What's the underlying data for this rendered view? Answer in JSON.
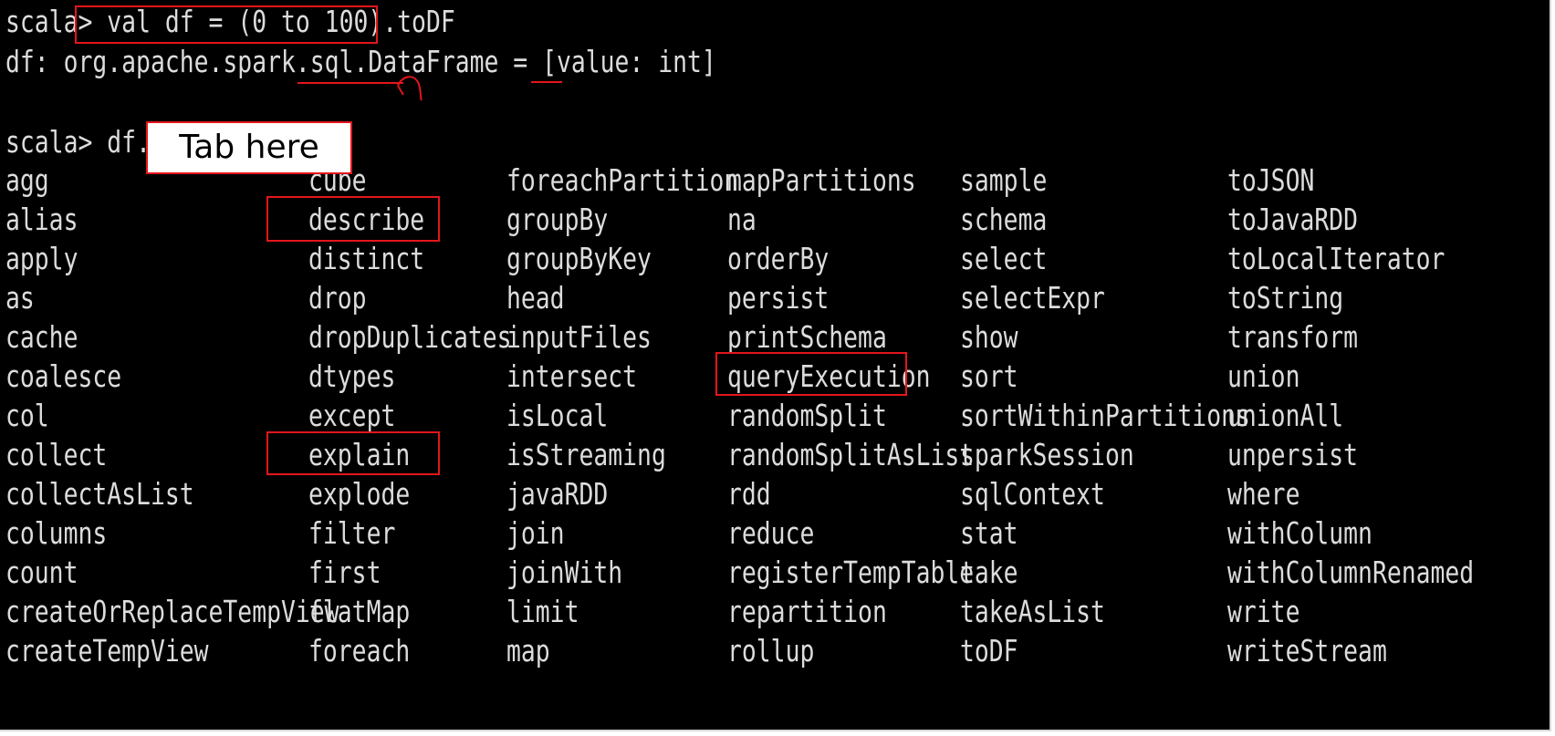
{
  "terminal": {
    "line1_prompt": "scala>",
    "line1_command": "val df = (0 to 100).toDF",
    "line2_output": "df: org.apache.spark.sql.DataFrame = [value: int]",
    "line3_prompt": "scala>",
    "line3_input": "df.",
    "callout_label": "Tab here"
  },
  "completions": {
    "columns": [
      [
        "agg",
        "alias",
        "apply",
        "as",
        "cache",
        "coalesce",
        "col",
        "collect",
        "collectAsList",
        "columns",
        "count",
        "createOrReplaceTempView",
        "createTempView"
      ],
      [
        "cube",
        "describe",
        "distinct",
        "drop",
        "dropDuplicates",
        "dtypes",
        "except",
        "explain",
        "explode",
        "filter",
        "first",
        "flatMap",
        "foreach"
      ],
      [
        "foreachPartition",
        "groupBy",
        "groupByKey",
        "head",
        "inputFiles",
        "intersect",
        "isLocal",
        "isStreaming",
        "javaRDD",
        "join",
        "joinWith",
        "limit",
        "map"
      ],
      [
        "mapPartitions",
        "na",
        "orderBy",
        "persist",
        "printSchema",
        "queryExecution",
        "randomSplit",
        "randomSplitAsList",
        "rdd",
        "reduce",
        "registerTempTable",
        "repartition",
        "rollup"
      ],
      [
        "sample",
        "schema",
        "select",
        "selectExpr",
        "show",
        "sort",
        "sortWithinPartitions",
        "sparkSession",
        "sqlContext",
        "stat",
        "take",
        "takeAsList",
        "toDF"
      ],
      [
        "toJSON",
        "toJavaRDD",
        "toLocalIterator",
        "toString",
        "transform",
        "union",
        "unionAll",
        "unpersist",
        "where",
        "withColumn",
        "withColumnRenamed",
        "write",
        "writeStream"
      ]
    ],
    "highlighted": [
      "describe",
      "explain",
      "queryExecution"
    ]
  },
  "colors": {
    "background": "#000000",
    "text": "#dcdcdc",
    "annotation": "#e3161b"
  }
}
